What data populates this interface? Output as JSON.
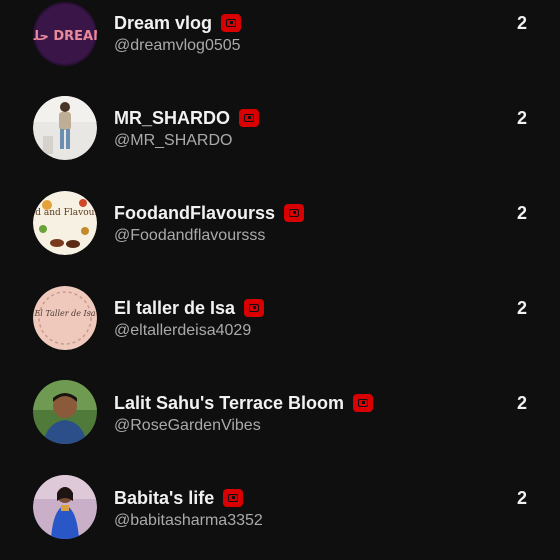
{
  "channels": [
    {
      "name": "Dream vlog",
      "handle": "@dreamvlog0505",
      "count": "2",
      "avatar_text": "حلم DREAM"
    },
    {
      "name": "MR_SHARDO",
      "handle": "@MR_SHARDO",
      "count": "2"
    },
    {
      "name": "FoodandFlavourss",
      "handle": "@Foodandflavoursss",
      "count": "2",
      "avatar_text": "Food and Flavourses"
    },
    {
      "name": "El taller de Isa",
      "handle": "@eltallerdeisa4029",
      "count": "2",
      "avatar_text": "El Taller de Isa"
    },
    {
      "name": "Lalit Sahu's Terrace Bloom",
      "handle": "@RoseGardenVibes",
      "count": "2"
    },
    {
      "name": "Babita's life",
      "handle": "@babitasharma3352",
      "count": "2"
    }
  ],
  "colors": {
    "background": "#0f0f0f",
    "badge": "#d80000",
    "primary_text": "#f1f1f1",
    "secondary_text": "#aaaaaa"
  },
  "icons": {
    "badge": "youtube-channel-icon"
  }
}
